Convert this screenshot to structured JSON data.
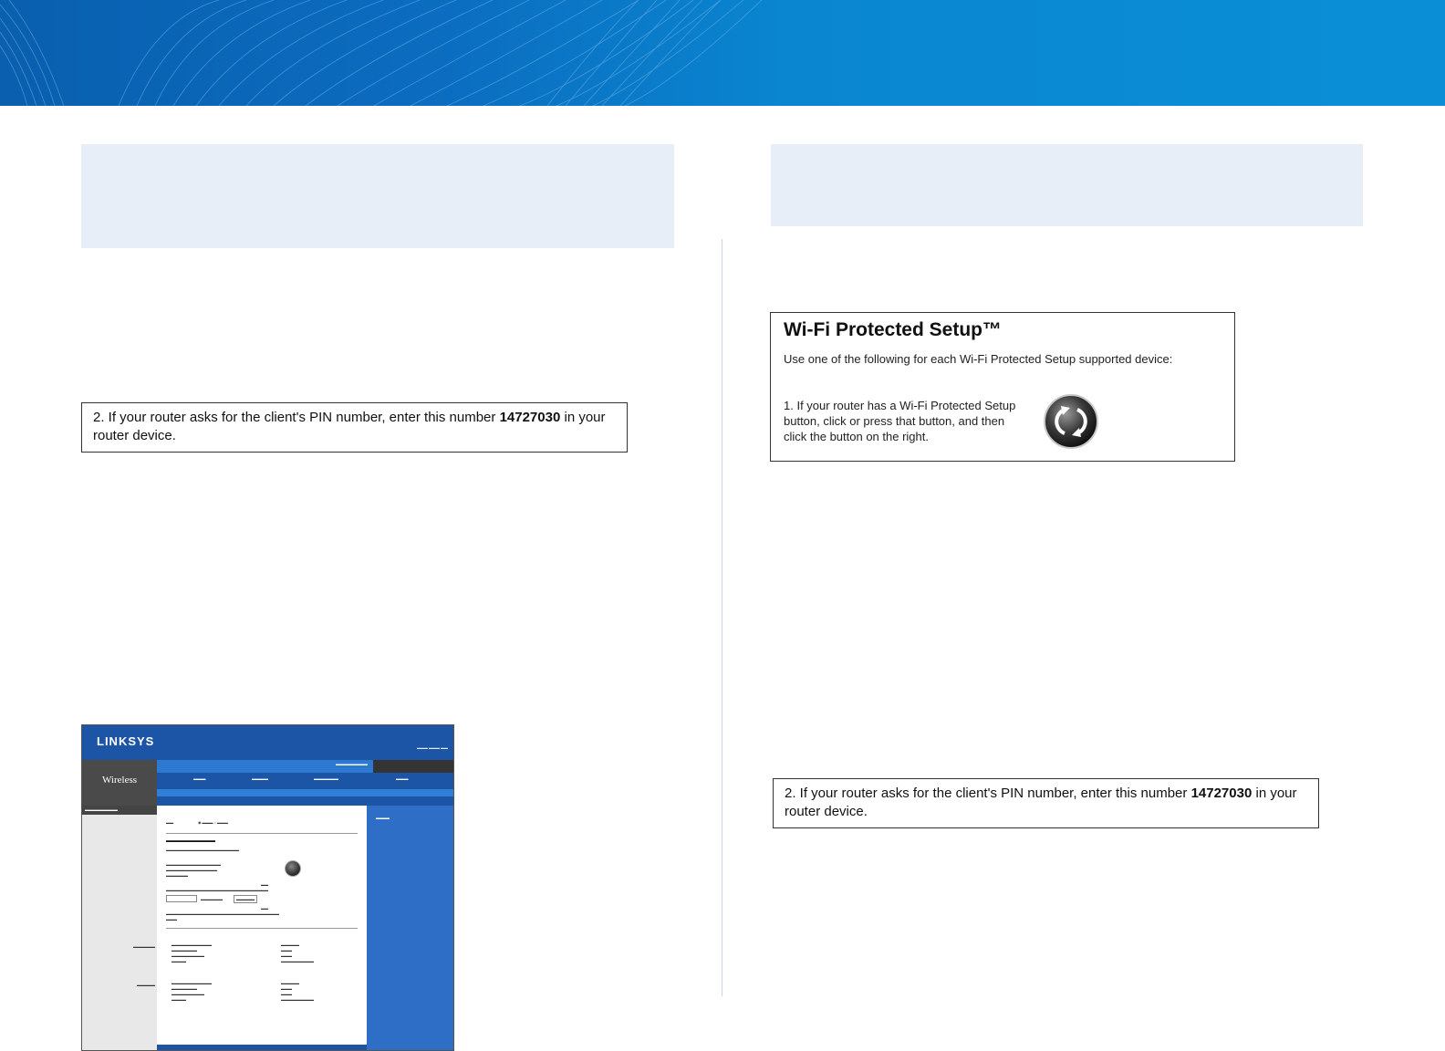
{
  "pin_box": {
    "text_before": "2. If your router asks for the client's PIN number, enter this number ",
    "pin": "14727030",
    "text_after": " in your router device."
  },
  "wps_panel": {
    "title": "Wi-Fi Protected Setup™",
    "subtitle": "Use one of the following for each Wi-Fi Protected Setup supported device:",
    "step1": "1. If your router has a Wi-Fi Protected Setup button, click or press that button, and then click the button on the right.",
    "button_icon": "wps-icon"
  },
  "linksys_screenshot": {
    "logo": "LINKSYS",
    "section": "Wireless"
  },
  "colors": {
    "banner_start": "#0a5fae",
    "banner_end": "#0a8fd6",
    "tint_box": "#e8eef8",
    "linksys_blue": "#1d55a6"
  }
}
